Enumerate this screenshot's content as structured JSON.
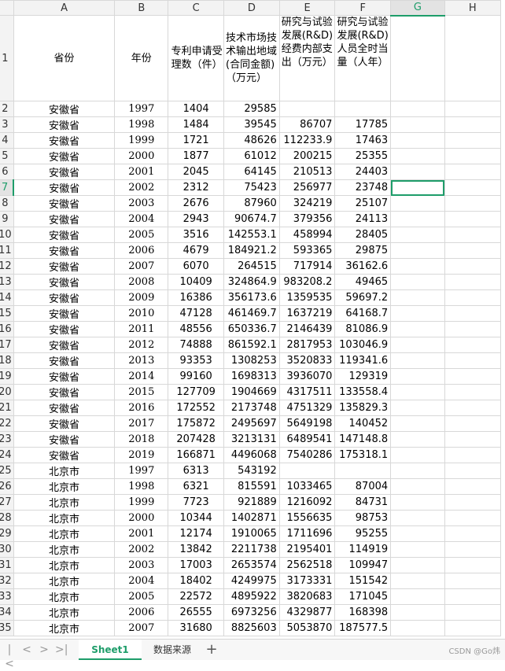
{
  "columns": [
    "A",
    "B",
    "C",
    "D",
    "E",
    "F",
    "G",
    "H"
  ],
  "selected_column": "G",
  "selected_row": "7",
  "header_row_number": "1",
  "headers": {
    "a": "省份",
    "b": "年份",
    "c": "专利申请受理数（件）",
    "d": "技术市场技术输出地域(合同金额)（万元）",
    "e": "研究与试验发展(R&D)经费内部支出（万元）",
    "f": "研究与试验发展(R&D)人员全时当量（人年）"
  },
  "rows": [
    {
      "n": "2",
      "a": "安徽省",
      "b": "1997",
      "c": "1404",
      "d": "29585",
      "e": "",
      "f": ""
    },
    {
      "n": "3",
      "a": "安徽省",
      "b": "1998",
      "c": "1484",
      "d": "39545",
      "e": "86707",
      "f": "17785"
    },
    {
      "n": "4",
      "a": "安徽省",
      "b": "1999",
      "c": "1721",
      "d": "48626",
      "e": "112233.9",
      "f": "17463"
    },
    {
      "n": "5",
      "a": "安徽省",
      "b": "2000",
      "c": "1877",
      "d": "61012",
      "e": "200215",
      "f": "25355"
    },
    {
      "n": "6",
      "a": "安徽省",
      "b": "2001",
      "c": "2045",
      "d": "64145",
      "e": "210513",
      "f": "24403"
    },
    {
      "n": "7",
      "a": "安徽省",
      "b": "2002",
      "c": "2312",
      "d": "75423",
      "e": "256977",
      "f": "23748"
    },
    {
      "n": "8",
      "a": "安徽省",
      "b": "2003",
      "c": "2676",
      "d": "87960",
      "e": "324219",
      "f": "25107"
    },
    {
      "n": "9",
      "a": "安徽省",
      "b": "2004",
      "c": "2943",
      "d": "90674.7",
      "e": "379356",
      "f": "24113"
    },
    {
      "n": "10",
      "a": "安徽省",
      "b": "2005",
      "c": "3516",
      "d": "142553.1",
      "e": "458994",
      "f": "28405"
    },
    {
      "n": "11",
      "a": "安徽省",
      "b": "2006",
      "c": "4679",
      "d": "184921.2",
      "e": "593365",
      "f": "29875"
    },
    {
      "n": "12",
      "a": "安徽省",
      "b": "2007",
      "c": "6070",
      "d": "264515",
      "e": "717914",
      "f": "36162.6"
    },
    {
      "n": "13",
      "a": "安徽省",
      "b": "2008",
      "c": "10409",
      "d": "324864.9",
      "e": "983208.2",
      "f": "49465"
    },
    {
      "n": "14",
      "a": "安徽省",
      "b": "2009",
      "c": "16386",
      "d": "356173.6",
      "e": "1359535",
      "f": "59697.2"
    },
    {
      "n": "15",
      "a": "安徽省",
      "b": "2010",
      "c": "47128",
      "d": "461469.7",
      "e": "1637219",
      "f": "64168.7"
    },
    {
      "n": "16",
      "a": "安徽省",
      "b": "2011",
      "c": "48556",
      "d": "650336.7",
      "e": "2146439",
      "f": "81086.9"
    },
    {
      "n": "17",
      "a": "安徽省",
      "b": "2012",
      "c": "74888",
      "d": "861592.1",
      "e": "2817953",
      "f": "103046.9"
    },
    {
      "n": "18",
      "a": "安徽省",
      "b": "2013",
      "c": "93353",
      "d": "1308253",
      "e": "3520833",
      "f": "119341.6"
    },
    {
      "n": "19",
      "a": "安徽省",
      "b": "2014",
      "c": "99160",
      "d": "1698313",
      "e": "3936070",
      "f": "129319"
    },
    {
      "n": "20",
      "a": "安徽省",
      "b": "2015",
      "c": "127709",
      "d": "1904669",
      "e": "4317511",
      "f": "133558.4"
    },
    {
      "n": "21",
      "a": "安徽省",
      "b": "2016",
      "c": "172552",
      "d": "2173748",
      "e": "4751329",
      "f": "135829.3"
    },
    {
      "n": "22",
      "a": "安徽省",
      "b": "2017",
      "c": "175872",
      "d": "2495697",
      "e": "5649198",
      "f": "140452"
    },
    {
      "n": "23",
      "a": "安徽省",
      "b": "2018",
      "c": "207428",
      "d": "3213131",
      "e": "6489541",
      "f": "147148.8"
    },
    {
      "n": "24",
      "a": "安徽省",
      "b": "2019",
      "c": "166871",
      "d": "4496068",
      "e": "7540286",
      "f": "175318.1"
    },
    {
      "n": "25",
      "a": "北京市",
      "b": "1997",
      "c": "6313",
      "d": "543192",
      "e": "",
      "f": ""
    },
    {
      "n": "26",
      "a": "北京市",
      "b": "1998",
      "c": "6321",
      "d": "815591",
      "e": "1033465",
      "f": "87004"
    },
    {
      "n": "27",
      "a": "北京市",
      "b": "1999",
      "c": "7723",
      "d": "921889",
      "e": "1216092",
      "f": "84731"
    },
    {
      "n": "28",
      "a": "北京市",
      "b": "2000",
      "c": "10344",
      "d": "1402871",
      "e": "1556635",
      "f": "98753"
    },
    {
      "n": "29",
      "a": "北京市",
      "b": "2001",
      "c": "12174",
      "d": "1910065",
      "e": "1711696",
      "f": "95255"
    },
    {
      "n": "30",
      "a": "北京市",
      "b": "2002",
      "c": "13842",
      "d": "2211738",
      "e": "2195401",
      "f": "114919"
    },
    {
      "n": "31",
      "a": "北京市",
      "b": "2003",
      "c": "17003",
      "d": "2653574",
      "e": "2562518",
      "f": "109947"
    },
    {
      "n": "32",
      "a": "北京市",
      "b": "2004",
      "c": "18402",
      "d": "4249975",
      "e": "3173331",
      "f": "151542"
    },
    {
      "n": "33",
      "a": "北京市",
      "b": "2005",
      "c": "22572",
      "d": "4895922",
      "e": "3820683",
      "f": "171045"
    },
    {
      "n": "34",
      "a": "北京市",
      "b": "2006",
      "c": "26555",
      "d": "6973256",
      "e": "4329877",
      "f": "168398"
    },
    {
      "n": "35",
      "a": "北京市",
      "b": "2007",
      "c": "31680",
      "d": "8825603",
      "e": "5053870",
      "f": "187577.5"
    }
  ],
  "tabs": {
    "sheet1": "Sheet1",
    "sheet2": "数据来源",
    "add": "+"
  },
  "nav": {
    "first": "|<",
    "prev": "<",
    "next": ">",
    "last": ">|"
  },
  "watermark": "CSDN @Go炜",
  "accent_color": "#1e9d6a"
}
